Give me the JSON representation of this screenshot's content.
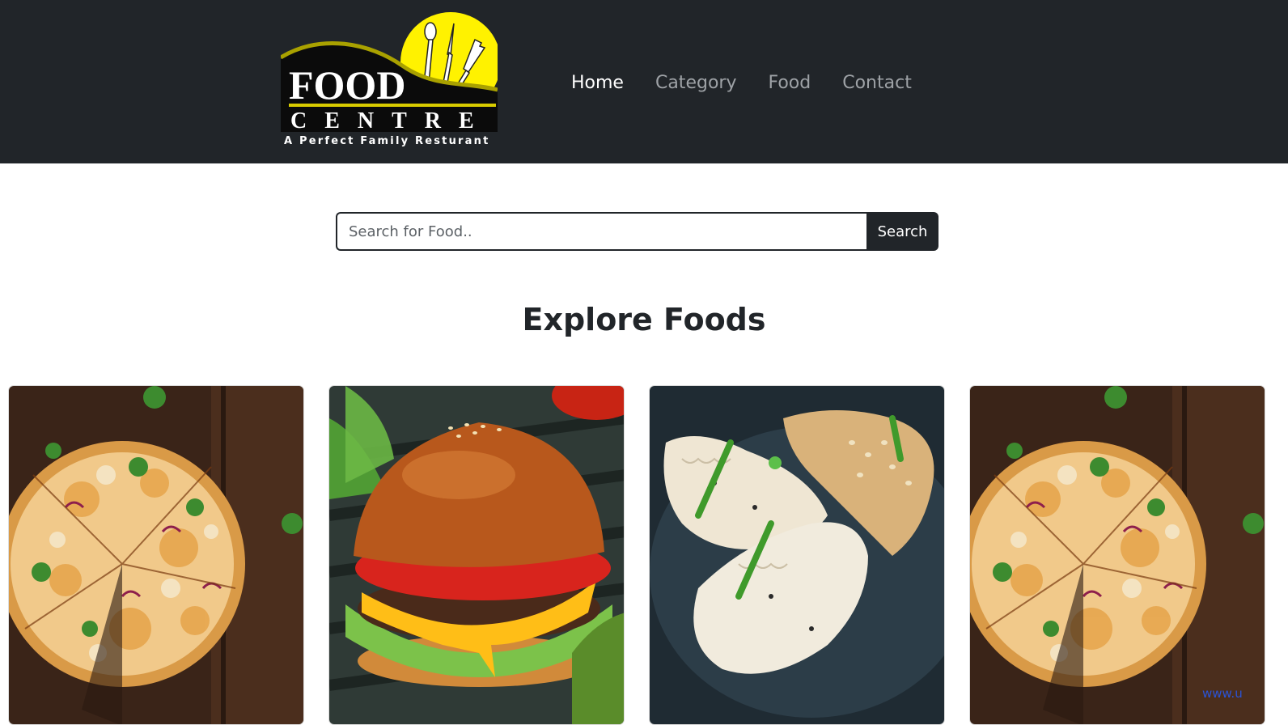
{
  "brand": {
    "logo_line1": "FOOD",
    "logo_line2": "CENTRE",
    "logo_tagline": "A Perfect Family Resturant",
    "logo_icon": "cutlery-sun-icon",
    "colors": {
      "navbar_bg": "#212529",
      "logo_sun": "#fff200",
      "logo_arc": "#a9a100"
    }
  },
  "nav": {
    "items": [
      {
        "label": "Home",
        "active": true
      },
      {
        "label": "Category",
        "active": false
      },
      {
        "label": "Food",
        "active": false
      },
      {
        "label": "Contact",
        "active": false
      }
    ]
  },
  "search": {
    "placeholder": "Search for Food..",
    "value": "",
    "button_label": "Search"
  },
  "explore": {
    "title": "Explore Foods",
    "cards": [
      {
        "image": "pizza-image"
      },
      {
        "image": "burger-image"
      },
      {
        "image": "dumplings-image"
      },
      {
        "image": "pizza-image"
      }
    ]
  },
  "footer_link": {
    "text": "www.u"
  }
}
